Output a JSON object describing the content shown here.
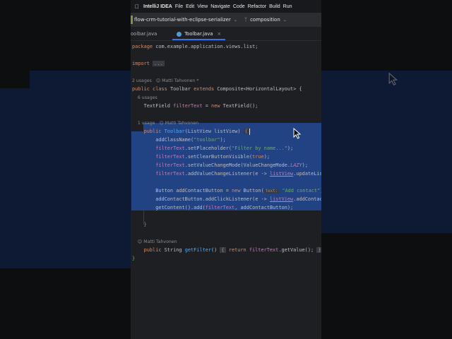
{
  "menubar": {
    "app": "IntelliJ IDEA",
    "items": [
      "File",
      "Edit",
      "View",
      "Navigate",
      "Code",
      "Refactor",
      "Build",
      "Run"
    ]
  },
  "project": {
    "name": "flow-crm-tutorial-with-eclipse-serializer",
    "branch": "composition"
  },
  "tabs": [
    {
      "label": "oolbar.java"
    },
    {
      "label": "Toolbar.java",
      "close": "×"
    }
  ],
  "code": [
    [
      [
        "package",
        "kw"
      ],
      [
        " com.example.application.views.list;",
        ""
      ]
    ],
    [],
    [
      [
        "import ",
        "kw"
      ],
      [
        "...",
        "fold"
      ]
    ],
    [],
    [
      [
        "2 usages   ",
        "gray"
      ],
      [
        "☺ Matti Tahvonen *",
        "gray"
      ]
    ],
    [
      [
        "public class ",
        "kw"
      ],
      [
        "Toolbar ",
        ""
      ],
      [
        "extends ",
        "kw"
      ],
      [
        "Composite<HorizontalLayout> {",
        ""
      ]
    ],
    [
      [
        "    6 usages",
        "gray"
      ]
    ],
    [
      [
        "    TextField ",
        ""
      ],
      [
        "filterText",
        "fld"
      ],
      [
        " = ",
        ""
      ],
      [
        "new ",
        "kw"
      ],
      [
        "TextField();",
        ""
      ]
    ],
    [],
    [
      [
        "    1 usage   ",
        "gray"
      ],
      [
        "☺ Matti Tahvonen",
        "gray"
      ]
    ],
    [
      [
        "    public ",
        "kw"
      ],
      [
        "Toolbar",
        "fn"
      ],
      [
        "(ListView listView) ",
        ""
      ],
      [
        "{",
        "caret"
      ]
    ],
    [
      [
        "        addClassName(",
        ""
      ],
      [
        "\"toolbar\"",
        "str"
      ],
      [
        ");",
        ""
      ]
    ],
    [
      [
        "        ",
        ""
      ],
      [
        "filterText",
        "fld"
      ],
      [
        ".setPlaceholder(",
        ""
      ],
      [
        "\"Filter by name...\"",
        "str"
      ],
      [
        ");",
        ""
      ]
    ],
    [
      [
        "        ",
        ""
      ],
      [
        "filterText",
        "fld"
      ],
      [
        ".setClearButtonVisible(",
        ""
      ],
      [
        "true",
        "kw"
      ],
      [
        ");",
        ""
      ]
    ],
    [
      [
        "        ",
        ""
      ],
      [
        "filterText",
        "fld"
      ],
      [
        ".setValueChangeMode(ValueChangeMode.",
        ""
      ],
      [
        "LAZY",
        "it"
      ],
      [
        ");",
        ""
      ]
    ],
    [
      [
        "        ",
        ""
      ],
      [
        "filterText",
        "fld"
      ],
      [
        ".addValueChangeListener(e -> ",
        ""
      ],
      [
        "listView",
        "ul"
      ],
      [
        ".updateList());",
        ""
      ]
    ],
    [],
    [
      [
        "        Button addContactButton = ",
        ""
      ],
      [
        "new ",
        "kw"
      ],
      [
        "Button(",
        ""
      ],
      [
        "text:",
        "hint"
      ],
      [
        " \"Add contact\");",
        "str"
      ]
    ],
    [
      [
        "        addContactButton.addClickListener(e -> ",
        ""
      ],
      [
        "listView",
        "ul"
      ],
      [
        ".addContact());",
        ""
      ]
    ],
    [
      [
        "        getContent().add(",
        ""
      ],
      [
        "filterText",
        "fld"
      ],
      [
        ", addContactButton);",
        ""
      ]
    ],
    [],
    [
      [
        "    }",
        "brace"
      ]
    ],
    [],
    [
      [
        "    ☺ Matti Tahvonen",
        "gray"
      ]
    ],
    [
      [
        "    public ",
        "kw"
      ],
      [
        "String ",
        ""
      ],
      [
        "getFilter",
        "fn"
      ],
      [
        "() ",
        ""
      ],
      [
        "{",
        "fold"
      ],
      [
        " return ",
        "kw"
      ],
      [
        "filterText",
        "fld"
      ],
      [
        ".getValue(); ",
        ""
      ],
      [
        "}",
        "fold"
      ]
    ],
    [
      [
        "}",
        "brace"
      ]
    ]
  ]
}
